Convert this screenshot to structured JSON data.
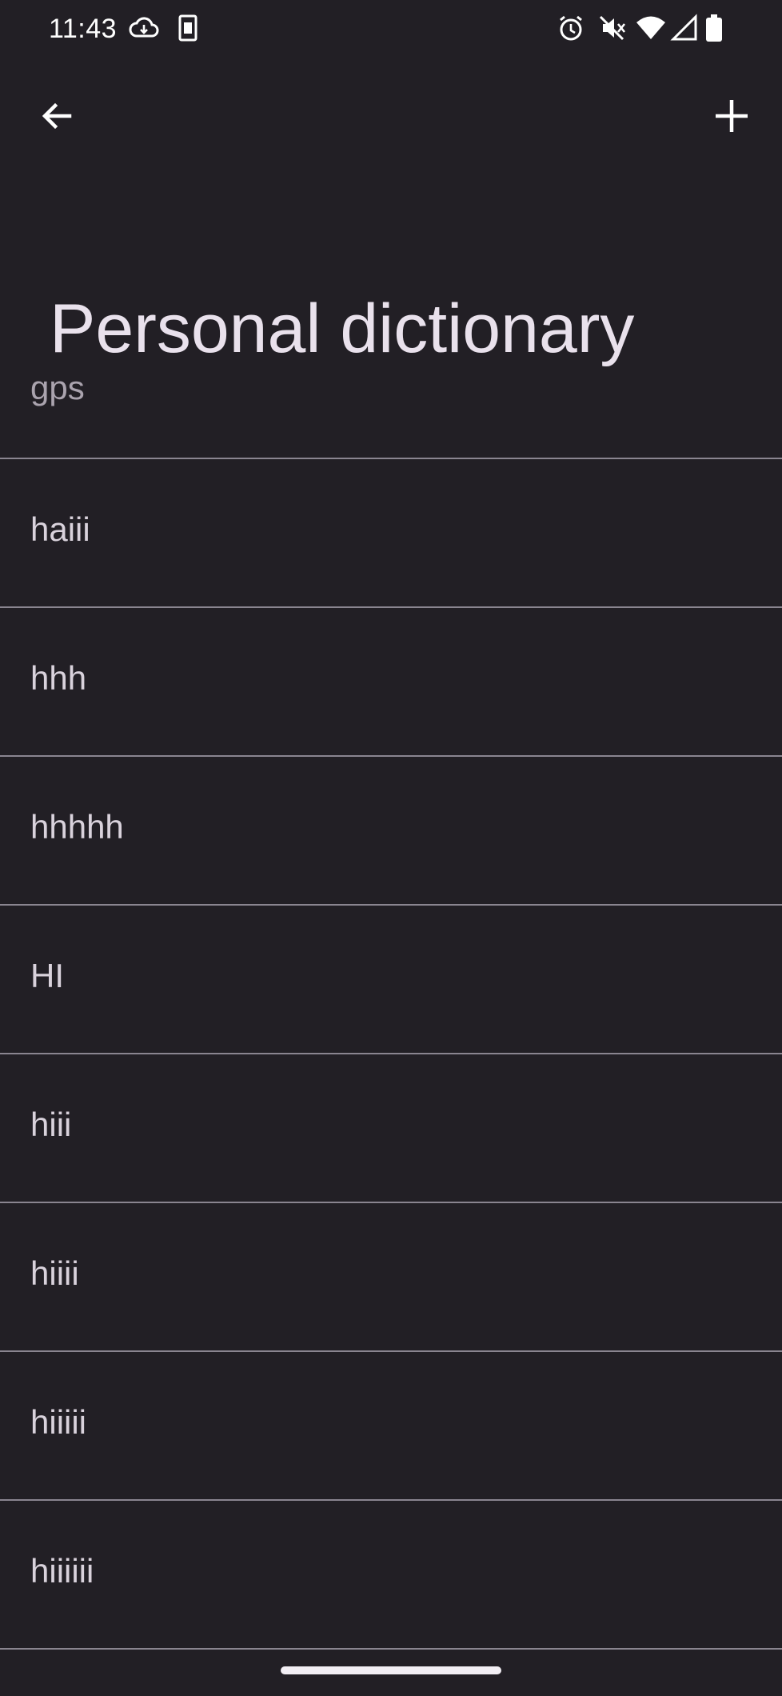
{
  "status_bar": {
    "time": "11:43",
    "icons": [
      "cloud-download-icon",
      "sim-card-icon",
      "alarm-icon",
      "mute-icon",
      "wifi-icon",
      "signal-icon",
      "battery-icon"
    ]
  },
  "app_bar": {
    "back_icon": "arrow-left-icon",
    "add_icon": "plus-icon"
  },
  "page": {
    "title": "Personal dictionary"
  },
  "words": [
    {
      "text": "gps"
    },
    {
      "text": "haiii"
    },
    {
      "text": "hhh"
    },
    {
      "text": "hhhhh"
    },
    {
      "text": "HI"
    },
    {
      "text": "hiii"
    },
    {
      "text": "hiiii"
    },
    {
      "text": "hiiiii"
    },
    {
      "text": "hiiiiii"
    }
  ],
  "colors": {
    "background": "#221f25",
    "title_text": "#e9e1ec",
    "item_text": "#d9d2dc",
    "divider": "#8a8590"
  }
}
